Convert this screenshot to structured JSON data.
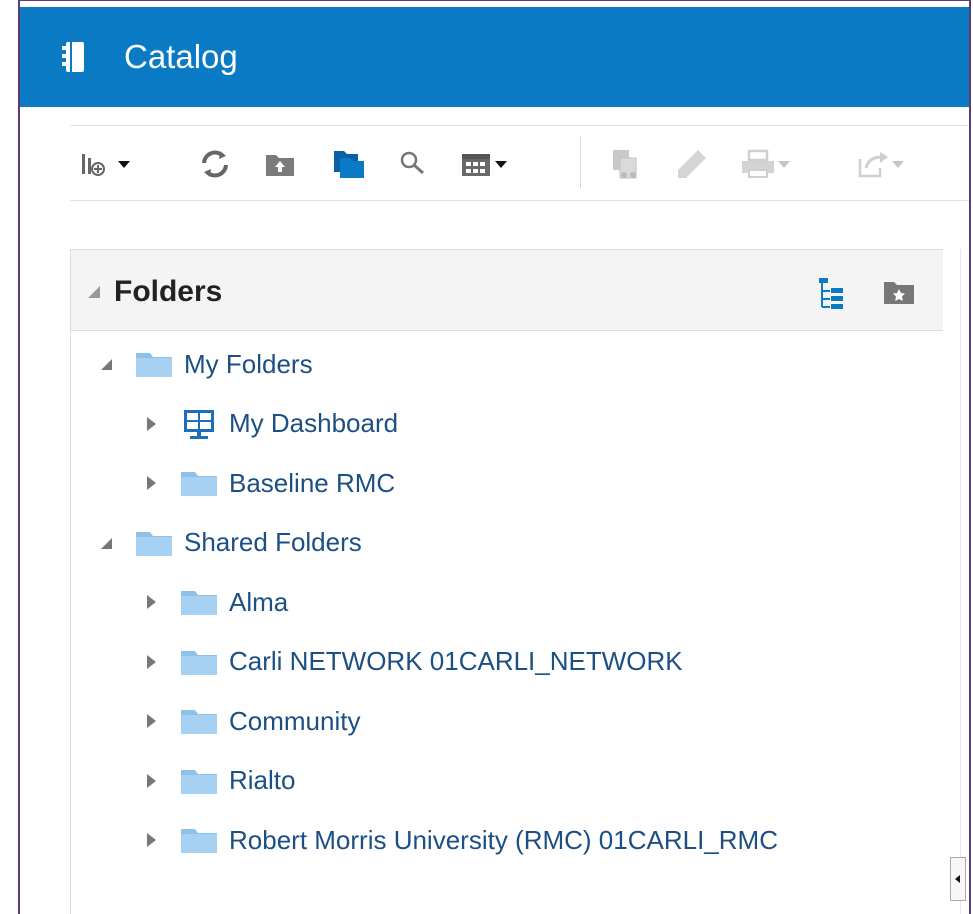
{
  "header": {
    "title": "Catalog",
    "icon": "book-icon",
    "color": "#0a7ac5"
  },
  "toolbar": {
    "buttons": [
      {
        "name": "new-menu-button",
        "icon": "new-chart-icon"
      },
      {
        "name": "refresh-button",
        "icon": "refresh-icon"
      },
      {
        "name": "upload-folder-button",
        "icon": "upload-folder-icon"
      },
      {
        "name": "show-folders-button",
        "icon": "folders-icon"
      },
      {
        "name": "search-button",
        "icon": "search-icon"
      },
      {
        "name": "view-menu-button",
        "icon": "calendar-grid-icon"
      },
      {
        "name": "copy-button",
        "icon": "copy-icon",
        "disabled": true
      },
      {
        "name": "edit-button",
        "icon": "pencil-icon",
        "disabled": true
      },
      {
        "name": "print-button",
        "icon": "printer-icon",
        "disabled": true
      },
      {
        "name": "export-button",
        "icon": "export-icon",
        "disabled": true
      }
    ]
  },
  "folders_panel": {
    "title": "Folders",
    "tree": [
      {
        "label": "My Folders",
        "level": 0,
        "expanded": true,
        "icon": "folder-icon"
      },
      {
        "label": "My Dashboard",
        "level": 1,
        "expanded": false,
        "icon": "dashboard-icon"
      },
      {
        "label": "Baseline RMC",
        "level": 1,
        "expanded": false,
        "icon": "folder-icon"
      },
      {
        "label": "Shared Folders",
        "level": 0,
        "expanded": true,
        "icon": "folder-icon"
      },
      {
        "label": "Alma",
        "level": 1,
        "expanded": false,
        "icon": "folder-icon"
      },
      {
        "label": "Carli NETWORK 01CARLI_NETWORK",
        "level": 1,
        "expanded": false,
        "icon": "folder-icon"
      },
      {
        "label": "Community",
        "level": 1,
        "expanded": false,
        "icon": "folder-icon"
      },
      {
        "label": "Rialto",
        "level": 1,
        "expanded": false,
        "icon": "folder-icon"
      },
      {
        "label": "Robert Morris University (RMC) 01CARLI_RMC",
        "level": 1,
        "expanded": false,
        "icon": "folder-icon"
      }
    ]
  },
  "right_pane": {
    "cut_header": "T"
  }
}
